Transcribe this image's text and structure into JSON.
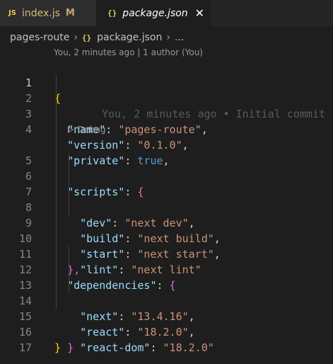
{
  "tabs": [
    {
      "icon": "JS",
      "name": "index.js",
      "badge": "M"
    },
    {
      "icon": "{}",
      "name": "package.json",
      "close": "✕"
    }
  ],
  "breadcrumb": {
    "folder": "pages-route",
    "sep": "›",
    "file_icon": "{}",
    "file": "package.json",
    "more": "..."
  },
  "codelens": {
    "blame": "You, 2 minutes ago | 1 author (You)",
    "debug": "Debug"
  },
  "inline_blame": "You, 2 minutes ago • Initial commit",
  "code": {
    "l1": "{",
    "name_key": "\"name\"",
    "name_val": "\"pages-route\"",
    "version_key": "\"version\"",
    "version_val": "\"0.1.0\"",
    "private_key": "\"private\"",
    "private_val": "true",
    "scripts_key": "\"scripts\"",
    "dev_key": "\"dev\"",
    "dev_val": "\"next dev\"",
    "build_key": "\"build\"",
    "build_val": "\"next build\"",
    "start_key": "\"start\"",
    "start_val": "\"next start\"",
    "lint_key": "\"lint\"",
    "lint_val": "\"next lint\"",
    "deps_key": "\"dependencies\"",
    "next_key": "\"next\"",
    "next_val": "\"13.4.16\"",
    "react_key": "\"react\"",
    "react_val": "\"18.2.0\"",
    "reactdom_key": "\"react-dom\"",
    "reactdom_val": "\"18.2.0\"",
    "open_brace": "{",
    "close_brace": "}",
    "close_brace_comma": "},",
    "colon": ": ",
    "comma": ","
  },
  "line_numbers": [
    "1",
    "2",
    "3",
    "4",
    "5",
    "6",
    "7",
    "8",
    "9",
    "10",
    "11",
    "12",
    "13",
    "14",
    "15",
    "16",
    "17"
  ],
  "colors": {
    "background": "#1e1e1e",
    "key": "#9cdcfe",
    "string": "#ce9178",
    "boolean": "#569cd6",
    "bracket_level1": "#ffd700",
    "bracket_level2": "#da70d6",
    "modified": "#d7ba7d"
  }
}
